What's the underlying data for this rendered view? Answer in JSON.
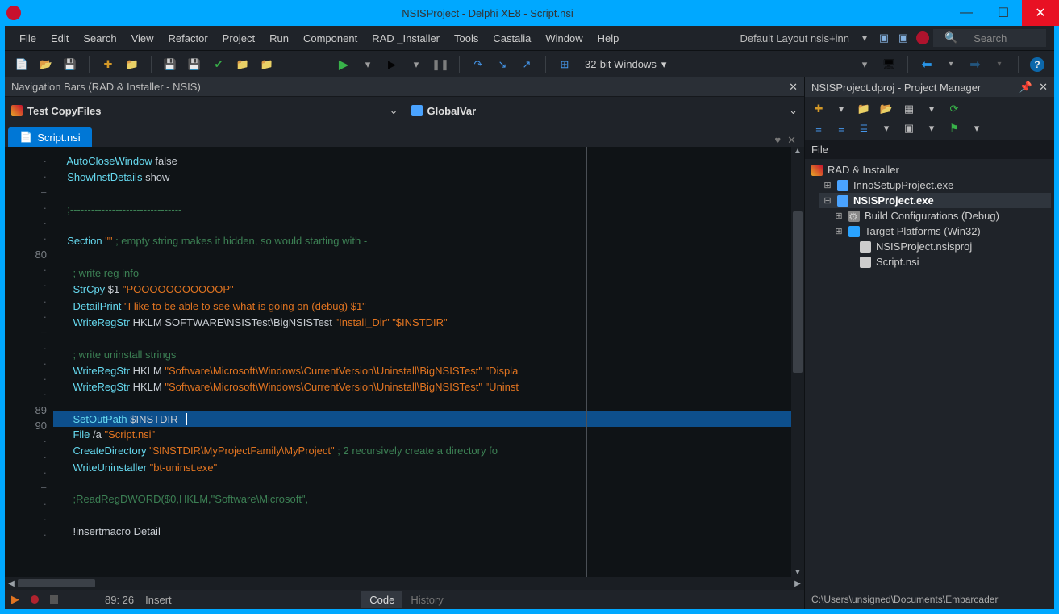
{
  "window": {
    "title": "NSISProject - Delphi XE8 - Script.nsi"
  },
  "menu": [
    "File",
    "Edit",
    "Search",
    "View",
    "Refactor",
    "Project",
    "Run",
    "Component",
    "RAD _Installer",
    "Tools",
    "Castalia",
    "Window",
    "Help"
  ],
  "layout_label": "Default Layout nsis+inn",
  "search_placeholder": "Search",
  "platform_label": "32-bit Windows",
  "navbars_title": "Navigation Bars (RAD & Installer - NSIS)",
  "nav_left": "Test CopyFiles",
  "nav_right": "GlobalVar",
  "tab_name": "Script.nsi",
  "gutter": [
    "·",
    "·",
    "−",
    "·",
    "·",
    "·",
    "80",
    "·",
    "·",
    "·",
    "·",
    "−",
    "·",
    "·",
    "·",
    "·",
    "89",
    "90",
    "·",
    "·",
    "·",
    "−",
    "·",
    "·",
    "·"
  ],
  "code": {
    "l1_a": "AutoCloseWindow",
    "l1_b": " false",
    "l2_a": "ShowInstDetails",
    "l2_b": " show",
    "l4": ";--------------------------------",
    "l6_a": "Section",
    "l6_b": " \"\"",
    "l6_c": " ; empty string makes it hidden, so would starting with -",
    "l8": "; write reg info",
    "l9_a": "StrCpy",
    "l9_b": " $1 ",
    "l9_c": "\"POOOOOOOOOOOP\"",
    "l10_a": "DetailPrint ",
    "l10_b": "\"I like to be able to see what is going on (debug) $1\"",
    "l11_a": "WriteRegStr",
    "l11_b": " HKLM",
    "l11_c": " SOFTWARE\\NSISTest\\BigNSISTest ",
    "l11_d": "\"Install_Dir\"",
    "l11_e": " \"$INSTDIR\"",
    "l13": "; write uninstall strings",
    "l14_a": "WriteRegStr",
    "l14_b": " HKLM ",
    "l14_c": "\"Software\\Microsoft\\Windows\\CurrentVersion\\Uninstall\\BigNSISTest\"",
    "l14_d": " \"Displa",
    "l15_a": "WriteRegStr",
    "l15_b": " HKLM ",
    "l15_c": "\"Software\\Microsoft\\Windows\\CurrentVersion\\Uninstall\\BigNSISTest\"",
    "l15_d": " \"Uninst",
    "l17_a": "SetOutPath",
    "l17_b": " $INSTDIR   ",
    "l18_a": "File",
    "l18_b": " /a ",
    "l18_c": "\"Script.nsi\"",
    "l19_a": "CreateDirectory ",
    "l19_b": "\"$INSTDIR\\MyProjectFamily\\MyProject\"",
    "l19_c": " ; 2 recursively create a directory fo",
    "l20_a": "WriteUninstaller ",
    "l20_b": "\"bt-uninst.exe\"",
    "l22": ";ReadRegDWORD($0,HKLM,\"Software\\Microsoft\",",
    "l24_a": "!insertmacro ",
    "l24_b": "Detail"
  },
  "status": {
    "pos": "89: 26",
    "mode": "Insert",
    "tab_code": "Code",
    "tab_history": "History"
  },
  "pm": {
    "title": "NSISProject.dproj - Project Manager",
    "file_label": "File",
    "root": "RAD & Installer",
    "n1": "InnoSetupProject.exe",
    "n2": "NSISProject.exe",
    "n3": "Build Configurations (Debug)",
    "n4": "Target Platforms (Win32)",
    "n5": "NSISProject.nsisproj",
    "n6": "Script.nsi",
    "path": "C:\\Users\\unsigned\\Documents\\Embarcader"
  }
}
